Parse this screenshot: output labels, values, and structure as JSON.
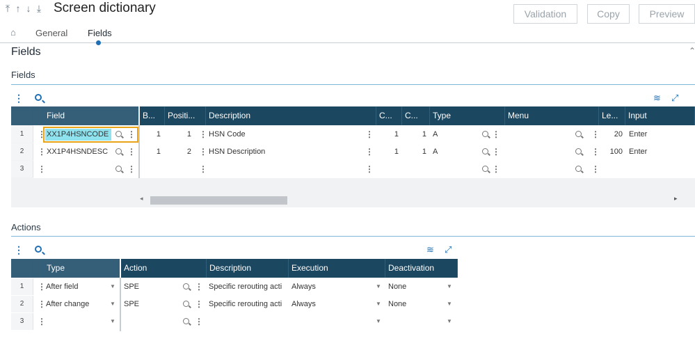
{
  "header": {
    "title": "Screen dictionary",
    "nav_arrows": [
      "⤒",
      "↑",
      "↓",
      "⤓"
    ],
    "buttons": {
      "validation": "Validation",
      "copy": "Copy",
      "preview": "Preview"
    }
  },
  "tabs": {
    "home_icon": "⌂",
    "general": "General",
    "fields": "Fields"
  },
  "page": {
    "section_title": "Fields"
  },
  "fields_block": {
    "title": "Fields",
    "columns": {
      "field": "Field",
      "b": "B...",
      "position": "Positi...",
      "description": "Description",
      "c1": "C...",
      "c2": "C...",
      "type": "Type",
      "menu": "Menu",
      "length": "Le...",
      "input": "Input"
    },
    "rows": [
      {
        "num": "1",
        "field": "XX1P4HSNCODE",
        "b": "1",
        "position": "1",
        "description": "HSN Code",
        "c1": "1",
        "c2": "1",
        "type": "A",
        "length": "20",
        "input": "Enter"
      },
      {
        "num": "2",
        "field": "XX1P4HSNDESC",
        "b": "1",
        "position": "2",
        "description": "HSN Description",
        "c1": "1",
        "c2": "1",
        "type": "A",
        "length": "100",
        "input": "Enter"
      },
      {
        "num": "3",
        "field": "",
        "b": "",
        "position": "",
        "description": "",
        "c1": "",
        "c2": "",
        "type": "",
        "length": "",
        "input": ""
      }
    ],
    "scroll": {
      "left_arrow": "◂",
      "right_arrow": "▸"
    }
  },
  "actions_block": {
    "title": "Actions",
    "columns": {
      "type": "Type",
      "action": "Action",
      "description": "Description",
      "execution": "Execution",
      "deactivation": "Deactivation"
    },
    "rows": [
      {
        "num": "1",
        "type": "After field",
        "action": "SPE",
        "description": "Specific rerouting acti",
        "execution": "Always",
        "deactivation": "None"
      },
      {
        "num": "2",
        "type": "After change",
        "action": "SPE",
        "description": "Specific rerouting acti",
        "execution": "Always",
        "deactivation": "None"
      },
      {
        "num": "3",
        "type": "",
        "action": "",
        "description": "",
        "execution": "",
        "deactivation": ""
      }
    ]
  },
  "icons": {
    "menu_dots": "⋮",
    "layers": "≋",
    "expand": "⤢",
    "caret": "▼"
  },
  "colors": {
    "header_bg": "#1c4760",
    "accent": "#1f6fb5",
    "selection": "#8fe3ef",
    "selection_border": "#e8a317"
  }
}
